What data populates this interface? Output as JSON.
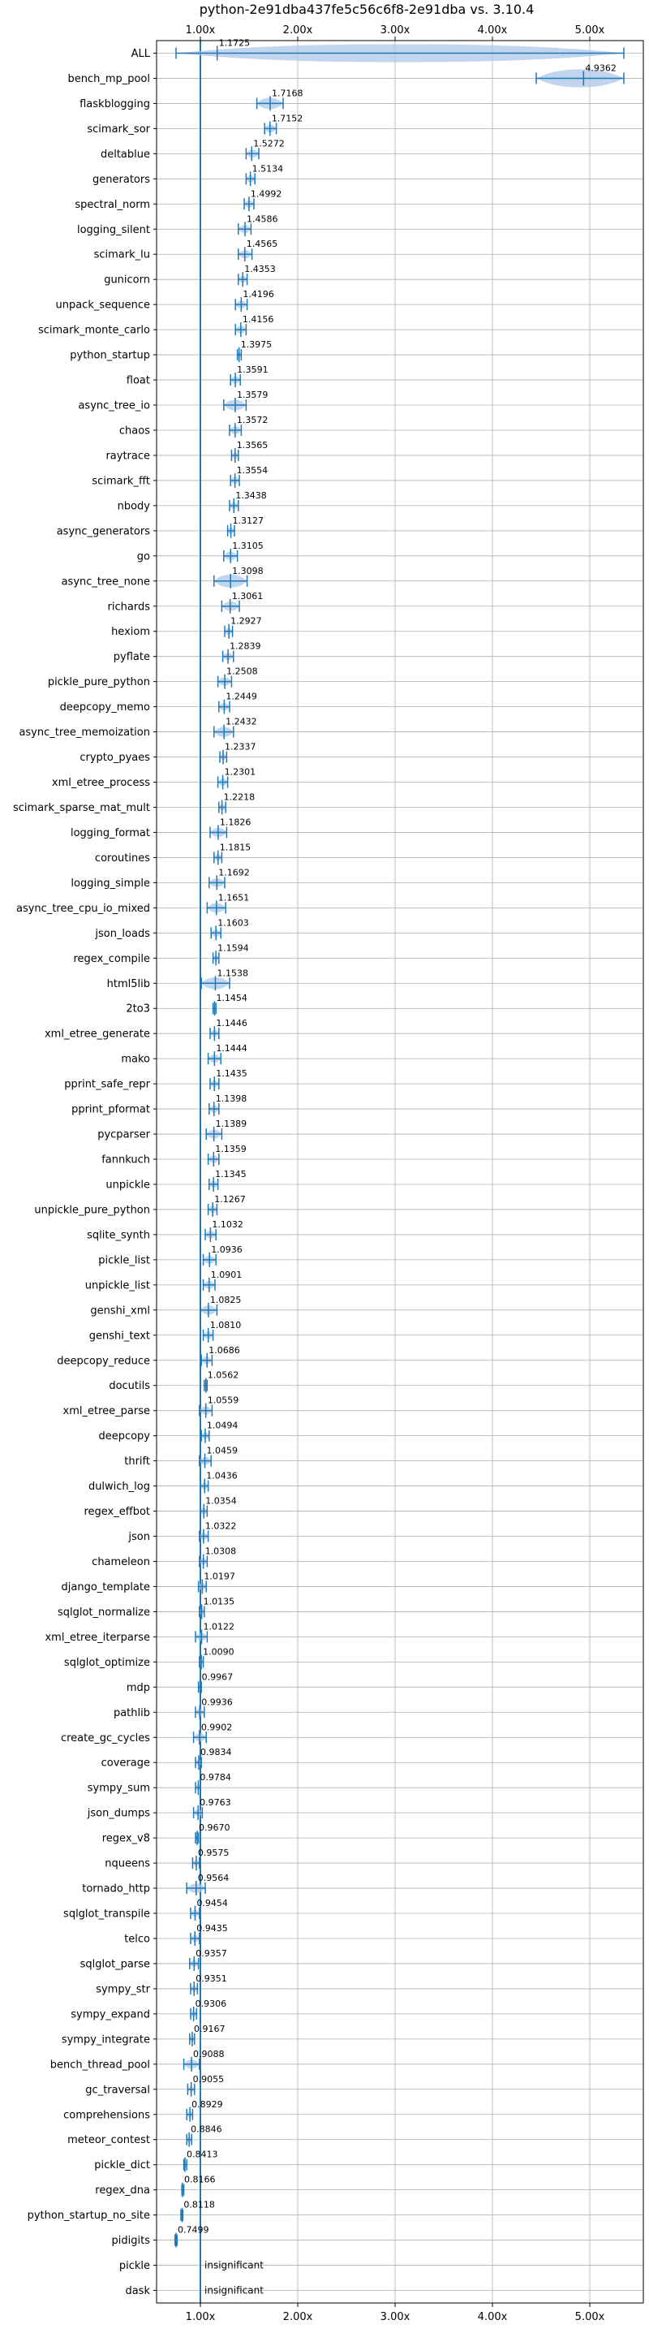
{
  "chart_data": {
    "type": "violin",
    "title": "python-2e91dba437fe5c56c6f8-2e91dba vs. 3.10.4",
    "xlabel": "",
    "ylabel": "",
    "xlim": [
      0.55,
      5.55
    ],
    "xticks": [
      {
        "value": 1.0,
        "label": "1.00x"
      },
      {
        "value": 2.0,
        "label": "2.00x"
      },
      {
        "value": 3.0,
        "label": "3.00x"
      },
      {
        "value": 4.0,
        "label": "4.00x"
      },
      {
        "value": 5.0,
        "label": "5.00x"
      }
    ],
    "reference_line": 1.0,
    "grid": true,
    "accent_color": "#1f77b4",
    "fill_color": "#aec7e8",
    "benchmarks": [
      {
        "name": "ALL",
        "value": 1.1725,
        "label": "1.1725",
        "min": 0.75,
        "max": 5.35
      },
      {
        "name": "bench_mp_pool",
        "value": 4.9362,
        "label": "4.9362",
        "min": 4.45,
        "max": 5.35
      },
      {
        "name": "flaskblogging",
        "value": 1.7168,
        "label": "1.7168",
        "min": 1.58,
        "max": 1.85
      },
      {
        "name": "scimark_sor",
        "value": 1.7152,
        "label": "1.7152",
        "min": 1.66,
        "max": 1.78
      },
      {
        "name": "deltablue",
        "value": 1.5272,
        "label": "1.5272",
        "min": 1.47,
        "max": 1.6
      },
      {
        "name": "generators",
        "value": 1.5134,
        "label": "1.5134",
        "min": 1.47,
        "max": 1.56
      },
      {
        "name": "spectral_norm",
        "value": 1.4992,
        "label": "1.4992",
        "min": 1.45,
        "max": 1.55
      },
      {
        "name": "logging_silent",
        "value": 1.4586,
        "label": "1.4586",
        "min": 1.39,
        "max": 1.52
      },
      {
        "name": "scimark_lu",
        "value": 1.4565,
        "label": "1.4565",
        "min": 1.39,
        "max": 1.53
      },
      {
        "name": "gunicorn",
        "value": 1.4353,
        "label": "1.4353",
        "min": 1.39,
        "max": 1.48
      },
      {
        "name": "unpack_sequence",
        "value": 1.4196,
        "label": "1.4196",
        "min": 1.36,
        "max": 1.48
      },
      {
        "name": "scimark_monte_carlo",
        "value": 1.4156,
        "label": "1.4156",
        "min": 1.36,
        "max": 1.47
      },
      {
        "name": "python_startup",
        "value": 1.3975,
        "label": "1.3975",
        "min": 1.38,
        "max": 1.42
      },
      {
        "name": "float",
        "value": 1.3591,
        "label": "1.3591",
        "min": 1.31,
        "max": 1.41
      },
      {
        "name": "async_tree_io",
        "value": 1.3579,
        "label": "1.3579",
        "min": 1.24,
        "max": 1.47
      },
      {
        "name": "chaos",
        "value": 1.3572,
        "label": "1.3572",
        "min": 1.3,
        "max": 1.42
      },
      {
        "name": "raytrace",
        "value": 1.3565,
        "label": "1.3565",
        "min": 1.32,
        "max": 1.39
      },
      {
        "name": "scimark_fft",
        "value": 1.3554,
        "label": "1.3554",
        "min": 1.31,
        "max": 1.4
      },
      {
        "name": "nbody",
        "value": 1.3438,
        "label": "1.3438",
        "min": 1.3,
        "max": 1.39
      },
      {
        "name": "async_generators",
        "value": 1.3127,
        "label": "1.3127",
        "min": 1.28,
        "max": 1.35
      },
      {
        "name": "go",
        "value": 1.3105,
        "label": "1.3105",
        "min": 1.24,
        "max": 1.38
      },
      {
        "name": "async_tree_none",
        "value": 1.3098,
        "label": "1.3098",
        "min": 1.14,
        "max": 1.48
      },
      {
        "name": "richards",
        "value": 1.3061,
        "label": "1.3061",
        "min": 1.22,
        "max": 1.4
      },
      {
        "name": "hexiom",
        "value": 1.2927,
        "label": "1.2927",
        "min": 1.25,
        "max": 1.33
      },
      {
        "name": "pyflate",
        "value": 1.2839,
        "label": "1.2839",
        "min": 1.23,
        "max": 1.34
      },
      {
        "name": "pickle_pure_python",
        "value": 1.2508,
        "label": "1.2508",
        "min": 1.18,
        "max": 1.32
      },
      {
        "name": "deepcopy_memo",
        "value": 1.2449,
        "label": "1.2449",
        "min": 1.19,
        "max": 1.3
      },
      {
        "name": "async_tree_memoization",
        "value": 1.2432,
        "label": "1.2432",
        "min": 1.14,
        "max": 1.34
      },
      {
        "name": "crypto_pyaes",
        "value": 1.2337,
        "label": "1.2337",
        "min": 1.2,
        "max": 1.27
      },
      {
        "name": "xml_etree_process",
        "value": 1.2301,
        "label": "1.2301",
        "min": 1.18,
        "max": 1.28
      },
      {
        "name": "scimark_sparse_mat_mult",
        "value": 1.2218,
        "label": "1.2218",
        "min": 1.19,
        "max": 1.26
      },
      {
        "name": "logging_format",
        "value": 1.1826,
        "label": "1.1826",
        "min": 1.1,
        "max": 1.27
      },
      {
        "name": "coroutines",
        "value": 1.1815,
        "label": "1.1815",
        "min": 1.14,
        "max": 1.22
      },
      {
        "name": "logging_simple",
        "value": 1.1692,
        "label": "1.1692",
        "min": 1.09,
        "max": 1.25
      },
      {
        "name": "async_tree_cpu_io_mixed",
        "value": 1.1651,
        "label": "1.1651",
        "min": 1.07,
        "max": 1.26
      },
      {
        "name": "json_loads",
        "value": 1.1603,
        "label": "1.1603",
        "min": 1.11,
        "max": 1.21
      },
      {
        "name": "regex_compile",
        "value": 1.1594,
        "label": "1.1594",
        "min": 1.13,
        "max": 1.19
      },
      {
        "name": "html5lib",
        "value": 1.1538,
        "label": "1.1538",
        "min": 1.01,
        "max": 1.3
      },
      {
        "name": "2to3",
        "value": 1.1454,
        "label": "1.1454",
        "min": 1.13,
        "max": 1.16
      },
      {
        "name": "xml_etree_generate",
        "value": 1.1446,
        "label": "1.1446",
        "min": 1.1,
        "max": 1.19
      },
      {
        "name": "mako",
        "value": 1.1444,
        "label": "1.1444",
        "min": 1.08,
        "max": 1.21
      },
      {
        "name": "pprint_safe_repr",
        "value": 1.1435,
        "label": "1.1435",
        "min": 1.1,
        "max": 1.19
      },
      {
        "name": "pprint_pformat",
        "value": 1.1398,
        "label": "1.1398",
        "min": 1.09,
        "max": 1.19
      },
      {
        "name": "pycparser",
        "value": 1.1389,
        "label": "1.1389",
        "min": 1.06,
        "max": 1.22
      },
      {
        "name": "fannkuch",
        "value": 1.1359,
        "label": "1.1359",
        "min": 1.08,
        "max": 1.19
      },
      {
        "name": "unpickle",
        "value": 1.1345,
        "label": "1.1345",
        "min": 1.09,
        "max": 1.18
      },
      {
        "name": "unpickle_pure_python",
        "value": 1.1267,
        "label": "1.1267",
        "min": 1.08,
        "max": 1.17
      },
      {
        "name": "sqlite_synth",
        "value": 1.1032,
        "label": "1.1032",
        "min": 1.05,
        "max": 1.16
      },
      {
        "name": "pickle_list",
        "value": 1.0936,
        "label": "1.0936",
        "min": 1.03,
        "max": 1.16
      },
      {
        "name": "unpickle_list",
        "value": 1.0901,
        "label": "1.0901",
        "min": 1.03,
        "max": 1.15
      },
      {
        "name": "genshi_xml",
        "value": 1.0825,
        "label": "1.0825",
        "min": 1.0,
        "max": 1.17
      },
      {
        "name": "genshi_text",
        "value": 1.081,
        "label": "1.0810",
        "min": 1.03,
        "max": 1.13
      },
      {
        "name": "deepcopy_reduce",
        "value": 1.0686,
        "label": "1.0686",
        "min": 1.01,
        "max": 1.12
      },
      {
        "name": "docutils",
        "value": 1.0562,
        "label": "1.0562",
        "min": 1.04,
        "max": 1.07
      },
      {
        "name": "xml_etree_parse",
        "value": 1.0559,
        "label": "1.0559",
        "min": 0.99,
        "max": 1.12
      },
      {
        "name": "deepcopy",
        "value": 1.0494,
        "label": "1.0494",
        "min": 1.01,
        "max": 1.09
      },
      {
        "name": "thrift",
        "value": 1.0459,
        "label": "1.0459",
        "min": 0.99,
        "max": 1.11
      },
      {
        "name": "dulwich_log",
        "value": 1.0436,
        "label": "1.0436",
        "min": 1.0,
        "max": 1.08
      },
      {
        "name": "regex_effbot",
        "value": 1.0354,
        "label": "1.0354",
        "min": 1.0,
        "max": 1.07
      },
      {
        "name": "json",
        "value": 1.0322,
        "label": "1.0322",
        "min": 0.99,
        "max": 1.08
      },
      {
        "name": "chameleon",
        "value": 1.0308,
        "label": "1.0308",
        "min": 0.99,
        "max": 1.07
      },
      {
        "name": "django_template",
        "value": 1.0197,
        "label": "1.0197",
        "min": 0.98,
        "max": 1.06
      },
      {
        "name": "sqlglot_normalize",
        "value": 1.0135,
        "label": "1.0135",
        "min": 0.99,
        "max": 1.04
      },
      {
        "name": "xml_etree_iterparse",
        "value": 1.0122,
        "label": "1.0122",
        "min": 0.95,
        "max": 1.07
      },
      {
        "name": "sqlglot_optimize",
        "value": 1.009,
        "label": "1.0090",
        "min": 0.99,
        "max": 1.03
      },
      {
        "name": "mdp",
        "value": 0.9967,
        "label": "0.9967",
        "min": 0.98,
        "max": 1.01
      },
      {
        "name": "pathlib",
        "value": 0.9936,
        "label": "0.9936",
        "min": 0.95,
        "max": 1.04
      },
      {
        "name": "create_gc_cycles",
        "value": 0.9902,
        "label": "0.9902",
        "min": 0.93,
        "max": 1.06
      },
      {
        "name": "coverage",
        "value": 0.9834,
        "label": "0.9834",
        "min": 0.95,
        "max": 1.01
      },
      {
        "name": "sympy_sum",
        "value": 0.9784,
        "label": "0.9784",
        "min": 0.95,
        "max": 1.0
      },
      {
        "name": "json_dumps",
        "value": 0.9763,
        "label": "0.9763",
        "min": 0.93,
        "max": 1.02
      },
      {
        "name": "regex_v8",
        "value": 0.967,
        "label": "0.9670",
        "min": 0.95,
        "max": 0.98
      },
      {
        "name": "nqueens",
        "value": 0.9575,
        "label": "0.9575",
        "min": 0.92,
        "max": 0.99
      },
      {
        "name": "tornado_http",
        "value": 0.9564,
        "label": "0.9564",
        "min": 0.86,
        "max": 1.05
      },
      {
        "name": "sqlglot_transpile",
        "value": 0.9454,
        "label": "0.9454",
        "min": 0.9,
        "max": 0.99
      },
      {
        "name": "telco",
        "value": 0.9435,
        "label": "0.9435",
        "min": 0.9,
        "max": 0.99
      },
      {
        "name": "sqlglot_parse",
        "value": 0.9357,
        "label": "0.9357",
        "min": 0.89,
        "max": 0.98
      },
      {
        "name": "sympy_str",
        "value": 0.9351,
        "label": "0.9351",
        "min": 0.9,
        "max": 0.97
      },
      {
        "name": "sympy_expand",
        "value": 0.9306,
        "label": "0.9306",
        "min": 0.9,
        "max": 0.96
      },
      {
        "name": "sympy_integrate",
        "value": 0.9167,
        "label": "0.9167",
        "min": 0.89,
        "max": 0.94
      },
      {
        "name": "bench_thread_pool",
        "value": 0.9088,
        "label": "0.9088",
        "min": 0.83,
        "max": 0.99
      },
      {
        "name": "gc_traversal",
        "value": 0.9055,
        "label": "0.9055",
        "min": 0.87,
        "max": 0.94
      },
      {
        "name": "comprehensions",
        "value": 0.8929,
        "label": "0.8929",
        "min": 0.86,
        "max": 0.92
      },
      {
        "name": "meteor_contest",
        "value": 0.8846,
        "label": "0.8846",
        "min": 0.86,
        "max": 0.91
      },
      {
        "name": "pickle_dict",
        "value": 0.8413,
        "label": "0.8413",
        "min": 0.83,
        "max": 0.86
      },
      {
        "name": "regex_dna",
        "value": 0.8166,
        "label": "0.8166",
        "min": 0.81,
        "max": 0.83
      },
      {
        "name": "python_startup_no_site",
        "value": 0.8118,
        "label": "0.8118",
        "min": 0.8,
        "max": 0.82
      },
      {
        "name": "pidigits",
        "value": 0.7499,
        "label": "0.7499",
        "min": 0.74,
        "max": 0.76
      },
      {
        "name": "pickle",
        "value": null,
        "label": "insignificant"
      },
      {
        "name": "dask",
        "value": null,
        "label": "insignificant"
      }
    ]
  }
}
